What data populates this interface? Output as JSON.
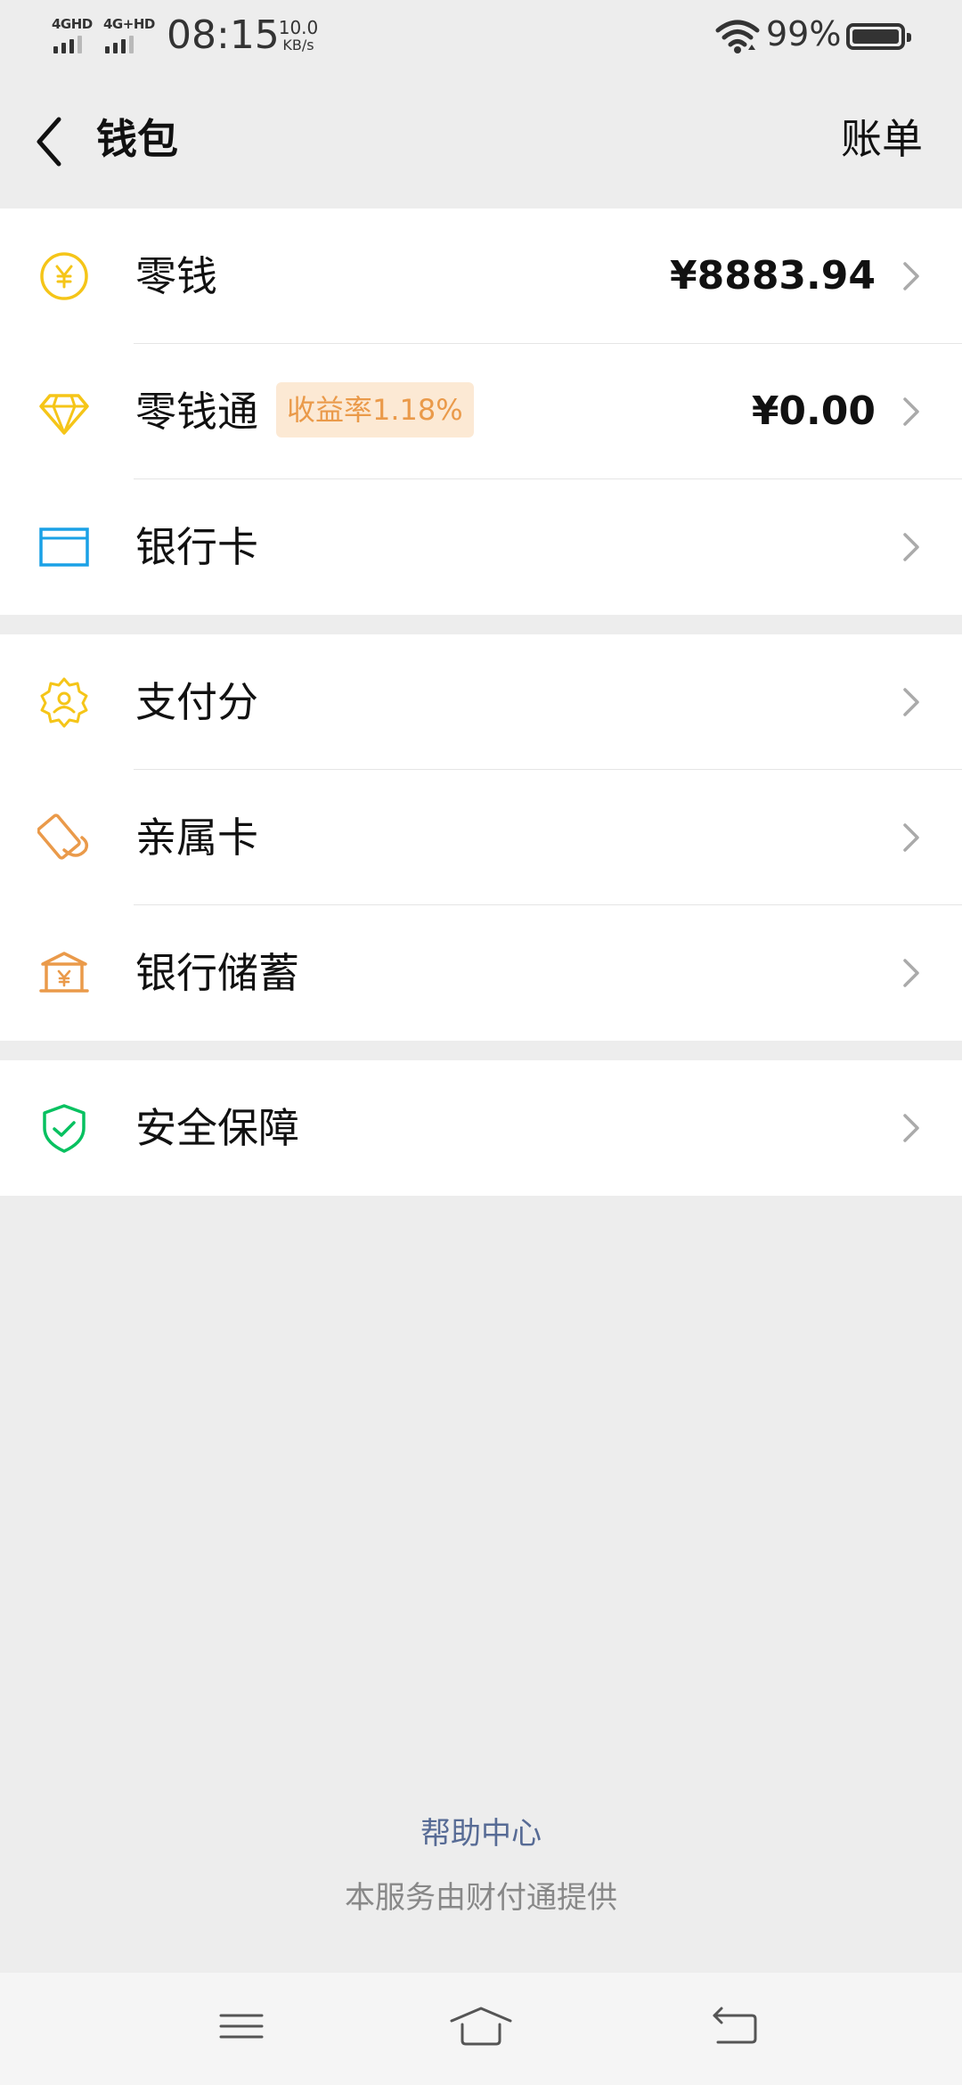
{
  "status_bar": {
    "signal1": "4GHD",
    "signal2": "4G+HD",
    "time": "08:15",
    "net_speed_value": "10.0",
    "net_speed_unit": "KB/s",
    "battery": "99%"
  },
  "header": {
    "title": "钱包",
    "bill_label": "账单"
  },
  "groups": [
    {
      "items": [
        {
          "label": "零钱",
          "amount": "¥8883.94",
          "icon": "coin-yuan-icon"
        },
        {
          "label": "零钱通",
          "badge": "收益率1.18%",
          "amount": "¥0.00",
          "icon": "diamond-icon"
        },
        {
          "label": "银行卡",
          "icon": "bank-card-icon"
        }
      ]
    },
    {
      "items": [
        {
          "label": "支付分",
          "icon": "payscore-badge-icon"
        },
        {
          "label": "亲属卡",
          "icon": "family-card-icon"
        },
        {
          "label": "银行储蓄",
          "icon": "bank-savings-icon"
        }
      ]
    },
    {
      "items": [
        {
          "label": "安全保障",
          "icon": "shield-check-icon"
        }
      ]
    }
  ],
  "footer": {
    "help_link": "帮助中心",
    "provider_note": "本服务由财付通提供"
  },
  "colors": {
    "background": "#ededed",
    "coin": "#f5c518",
    "diamond": "#f5c518",
    "bank_card": "#1aa1e6",
    "orange": "#ea9a4a",
    "shield": "#07c160",
    "link": "#576b95"
  }
}
